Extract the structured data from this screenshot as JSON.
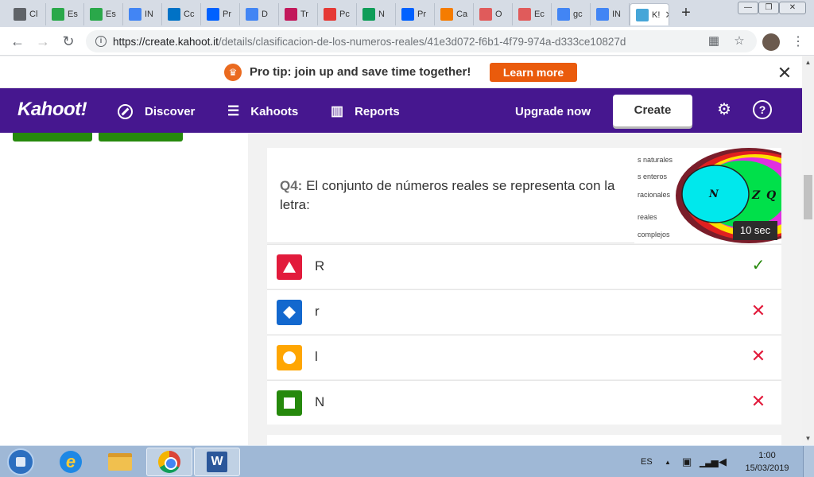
{
  "browser": {
    "tabs": [
      {
        "label": "Cl",
        "icon": "classroom-icon",
        "color": "#5f6368"
      },
      {
        "label": "Es",
        "icon": "edmodo-icon",
        "color": "#2aa84a"
      },
      {
        "label": "Es",
        "icon": "edmodo-icon",
        "color": "#2aa84a"
      },
      {
        "label": "IN",
        "icon": "google-icon",
        "color": "#4285f4"
      },
      {
        "label": "Cc",
        "icon": "outlook-icon",
        "color": "#0072c6"
      },
      {
        "label": "Pr",
        "icon": "dropbox-icon",
        "color": "#0061ff"
      },
      {
        "label": "D",
        "icon": "docs-icon",
        "color": "#4285f4"
      },
      {
        "label": "Tr",
        "icon": "profile-icon",
        "color": "#c2185b"
      },
      {
        "label": "Pc",
        "icon": "pen-icon",
        "color": "#e53935"
      },
      {
        "label": "N",
        "icon": "drive-icon",
        "color": "#0f9d58"
      },
      {
        "label": "Pr",
        "icon": "dropbox-icon",
        "color": "#0061ff"
      },
      {
        "label": "Ca",
        "icon": "moodle-icon",
        "color": "#f57c00"
      },
      {
        "label": "O",
        "icon": "s-icon",
        "color": "#e05b5b"
      },
      {
        "label": "Ec",
        "icon": "s-icon",
        "color": "#e05b5b"
      },
      {
        "label": "gc",
        "icon": "google-icon",
        "color": "#4285f4"
      },
      {
        "label": "IN",
        "icon": "google-icon",
        "color": "#4285f4"
      },
      {
        "label": "K!",
        "icon": "kahoot-icon",
        "color": "#46a6d8",
        "active": true
      }
    ],
    "url_host": "https://create.kahoot.it",
    "url_path": "/details/clasificacion-de-los-numeros-reales/41e3d072-f6b1-4f79-974a-d333ce10827d"
  },
  "banner": {
    "text": "Pro tip: join up and save time together!",
    "button": "Learn more"
  },
  "nav": {
    "logo": "Kahoot!",
    "discover": "Discover",
    "kahoots": "Kahoots",
    "reports": "Reports",
    "upgrade": "Upgrade now",
    "create": "Create"
  },
  "question": {
    "number": "Q4:",
    "text": "El conjunto de números reales se representa con la letra:",
    "time": "10 sec",
    "image_labels": [
      "s naturales",
      "s enteros",
      "racionales",
      "reales",
      "complejos"
    ],
    "image_letters": [
      "N",
      "Z",
      "Q"
    ]
  },
  "answers": [
    {
      "text": "R",
      "shape": "triangle",
      "color": "#e21b3c",
      "correct": true
    },
    {
      "text": "r",
      "shape": "diamond",
      "color": "#1368ce",
      "correct": false
    },
    {
      "text": "l",
      "shape": "circle",
      "color": "#ffa602",
      "correct": false
    },
    {
      "text": "N",
      "shape": "square",
      "color": "#26890c",
      "correct": false
    }
  ],
  "taskbar": {
    "lang": "ES",
    "time": "1:00",
    "date": "15/03/2019"
  }
}
